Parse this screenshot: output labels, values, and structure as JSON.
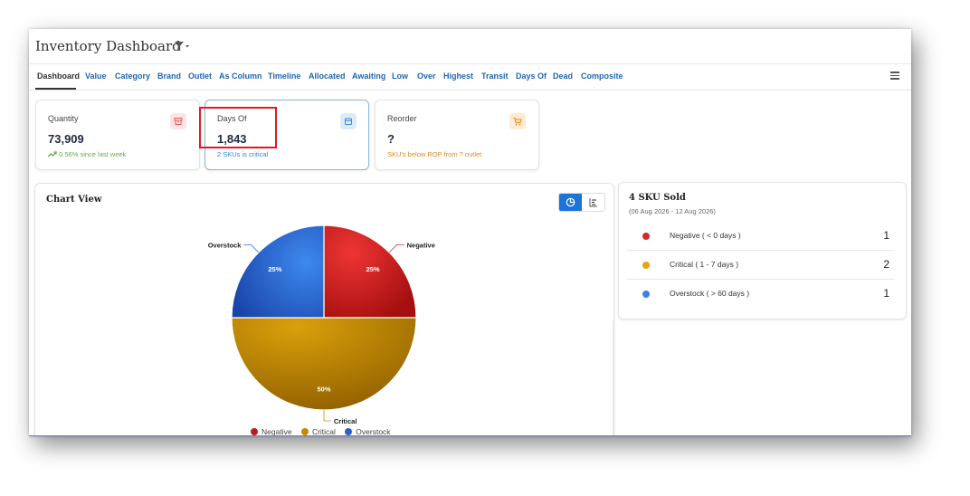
{
  "app": {
    "title": "Inventory Dashboard"
  },
  "nav": {
    "tabs": [
      {
        "label": "Dashboard",
        "active": true
      },
      {
        "label": "Value"
      },
      {
        "label": "Category"
      },
      {
        "label": "Brand"
      },
      {
        "label": "Outlet"
      },
      {
        "label": "As Column"
      },
      {
        "label": "Timeline"
      },
      {
        "label": "Allocated"
      },
      {
        "label": "Awaiting"
      },
      {
        "label": "Low"
      },
      {
        "label": "Over"
      },
      {
        "label": "Highest"
      },
      {
        "label": "Transit"
      },
      {
        "label": "Days Of"
      },
      {
        "label": "Dead"
      },
      {
        "label": "Composite"
      }
    ]
  },
  "cards": [
    {
      "title": "Quantity",
      "value": "73,909",
      "sub": "0.56% since last week",
      "icon": "archive-icon",
      "color": "#e35b5b",
      "sub_color": "#6aa84f"
    },
    {
      "title": "Days Of",
      "value": "1,843",
      "sub": "2 SKUs is critical",
      "icon": "calendar-icon",
      "color": "#3a86d4",
      "sub_color": "#3a86d4"
    },
    {
      "title": "Reorder",
      "value": "?",
      "sub": "SKU's below ROP from ? outlet",
      "icon": "cart-icon",
      "color": "#e68a1e",
      "sub_color": "#d88a23"
    }
  ],
  "chart_panel": {
    "title": "Chart View"
  },
  "chart_data": {
    "type": "pie",
    "slices": [
      {
        "label": "Negative",
        "value": 25,
        "color": "#d42a2a"
      },
      {
        "label": "Critical",
        "value": 50,
        "color": "#c99305"
      },
      {
        "label": "Overstock",
        "value": 25,
        "color": "#2a6fd6"
      }
    ],
    "slice_labels": [
      "25%",
      "50%",
      "25%"
    ],
    "legend": [
      "Negative",
      "Critical",
      "Overstock"
    ],
    "legend_position": "bottom"
  },
  "sku_panel": {
    "title": "4 SKU Sold",
    "date_range": "(06 Aug 2026 - 12 Aug 2026)",
    "rows": [
      {
        "label": "Negative ( < 0 days )",
        "count": "1",
        "color": "#d42a2a"
      },
      {
        "label": "Critical ( 1 - 7 days )",
        "count": "2",
        "color": "#e2a70c"
      },
      {
        "label": "Overstock ( > 60 days )",
        "count": "1",
        "color": "#3b82e8"
      }
    ]
  }
}
